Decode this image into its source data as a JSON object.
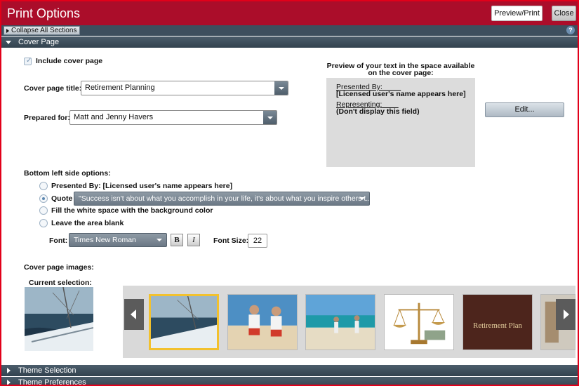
{
  "window": {
    "title": "Print Options",
    "preview_print_label": "Preview/Print",
    "close_label": "Close"
  },
  "toolbar": {
    "collapse_all_label": "Collapse All Sections",
    "help_glyph": "?"
  },
  "sections": {
    "cover_page": "Cover Page",
    "theme_selection": "Theme Selection",
    "theme_preferences": "Theme Preferences"
  },
  "cover": {
    "include_label": "Include cover page",
    "include_checked": true,
    "title_label": "Cover page title:",
    "title_value": "Retirement Planning",
    "prepared_label": "Prepared for:",
    "prepared_value": "Matt and Jenny Havers"
  },
  "preview": {
    "heading_line1": "Preview of your text in the space available",
    "heading_line2": "on the cover page:",
    "presented_by": "Presented By:",
    "presented_value": "[Licensed user's name appears here]",
    "representing": "Representing:",
    "representing_value": "(Don't display this field)",
    "edit_label": "Edit..."
  },
  "bottom_left": {
    "heading": "Bottom left side options:",
    "options": [
      {
        "label": "Presented By: [Licensed user's name appears here]",
        "selected": false
      },
      {
        "label": "Quote",
        "selected": true
      },
      {
        "label": "Fill the white space with the background color",
        "selected": false
      },
      {
        "label": "Leave the area blank",
        "selected": false
      }
    ],
    "quote_value": "\"Success isn't about what you accomplish in your life, it's about what you inspire others t...",
    "font_label": "Font:",
    "font_value": "Times New Roman",
    "bold_label": "B",
    "italic_label": "I",
    "font_size_label": "Font Size:",
    "font_size_value": "22"
  },
  "images": {
    "heading": "Cover page images:",
    "current_label": "Current selection:",
    "thumbnails": [
      {
        "name": "sailboat",
        "selected": true
      },
      {
        "name": "children-running",
        "selected": false
      },
      {
        "name": "couple-on-beach",
        "selected": false
      },
      {
        "name": "scales-of-justice",
        "selected": false
      },
      {
        "name": "retirement-plan-book",
        "selected": false
      },
      {
        "name": "partial-thumbnail",
        "selected": false
      }
    ],
    "book_text": "Retirement Plan"
  },
  "colors": {
    "title_bar": "#ab0d2a",
    "section_bar": "#3d4f5e",
    "selected_thumb": "#f2c12e"
  }
}
